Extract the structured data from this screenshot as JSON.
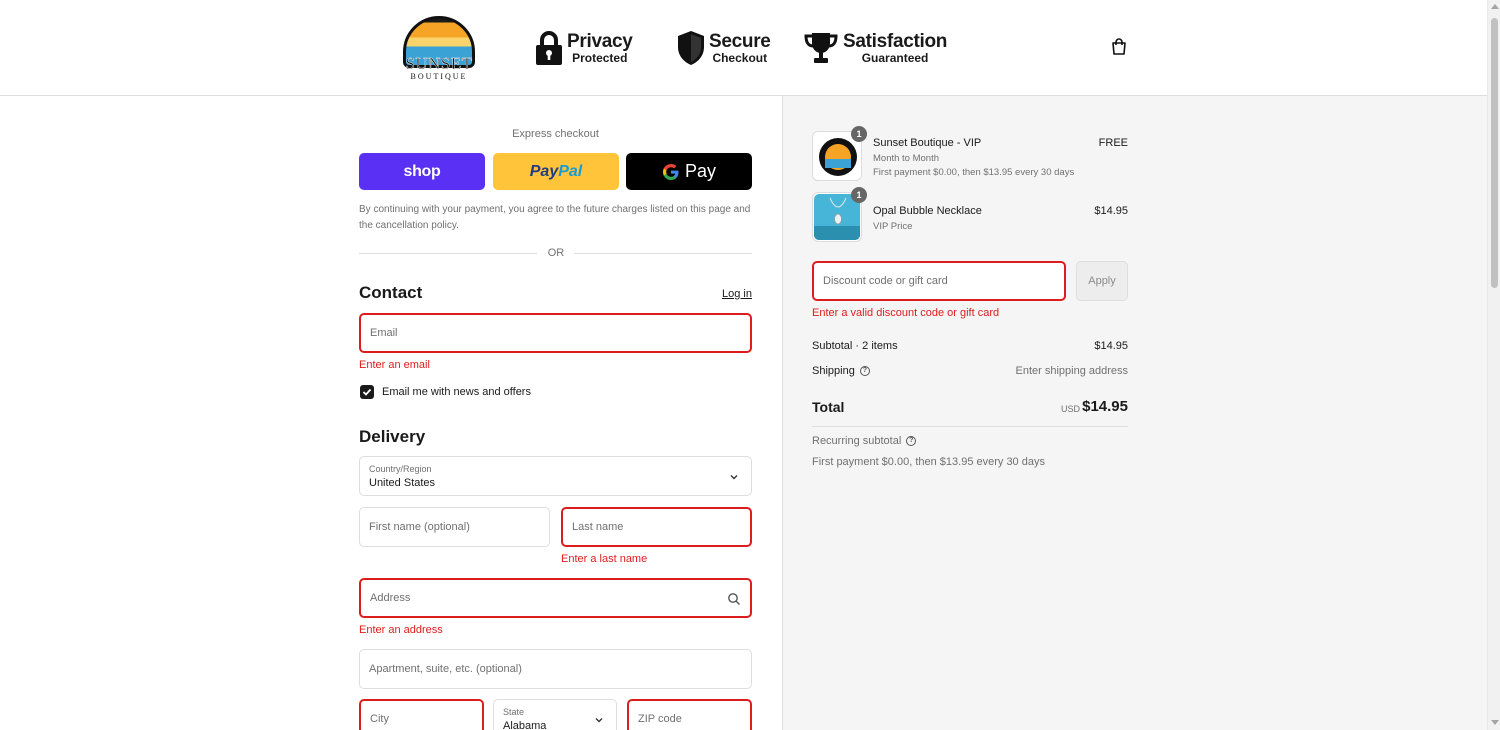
{
  "header": {
    "logo": {
      "word": "SUNSET",
      "sub": "BOUTIQUE"
    },
    "badges": [
      {
        "big": "Privacy",
        "small": "Protected",
        "icon": "padlock-icon"
      },
      {
        "big": "Secure",
        "small": "Checkout",
        "icon": "shield-icon"
      },
      {
        "big": "Satisfaction",
        "small": "Guaranteed",
        "icon": "trophy-icon"
      }
    ]
  },
  "express": {
    "label": "Express checkout",
    "shop": "shop",
    "paypal_a": "Pay",
    "paypal_b": "Pal",
    "gpay_g": "G",
    "gpay_text": "Pay",
    "agree": "By continuing with your payment, you agree to the future charges listed on this page and the cancellation policy.",
    "or": "OR"
  },
  "contact": {
    "title": "Contact",
    "login": "Log in",
    "email_placeholder": "Email",
    "email_error": "Enter an email",
    "newsletter_label": "Email me with news and offers",
    "newsletter_checked": true
  },
  "delivery": {
    "title": "Delivery",
    "country_label": "Country/Region",
    "country_value": "United States",
    "first_name_placeholder": "First name (optional)",
    "last_name_placeholder": "Last name",
    "last_name_error": "Enter a last name",
    "address_placeholder": "Address",
    "address_error": "Enter an address",
    "apt_placeholder": "Apartment, suite, etc. (optional)",
    "city_placeholder": "City",
    "state_label": "State",
    "state_value": "Alabama",
    "zip_placeholder": "ZIP code"
  },
  "summary": {
    "items": [
      {
        "qty": "1",
        "name": "Sunset Boutique - VIP",
        "sub1": "Month to Month",
        "sub2": "First payment $0.00, then $13.95 every 30 days",
        "price": "FREE"
      },
      {
        "qty": "1",
        "name": "Opal Bubble Necklace",
        "sub1": "VIP Price",
        "price": "$14.95"
      }
    ],
    "discount_placeholder": "Discount code or gift card",
    "apply": "Apply",
    "discount_error": "Enter a valid discount code or gift card",
    "subtotal_label": "Subtotal · 2 items",
    "subtotal_value": "$14.95",
    "shipping_label": "Shipping",
    "shipping_value": "Enter shipping address",
    "total_label": "Total",
    "total_currency": "USD",
    "total_value": "$14.95",
    "recurring_label": "Recurring subtotal",
    "recurring_value": "First payment $0.00, then $13.95 every 30 days"
  },
  "colors": {
    "error": "#dd1d1d",
    "shop_pay": "#5a31f4",
    "paypal": "#ffc439",
    "gpay": "#000000"
  }
}
